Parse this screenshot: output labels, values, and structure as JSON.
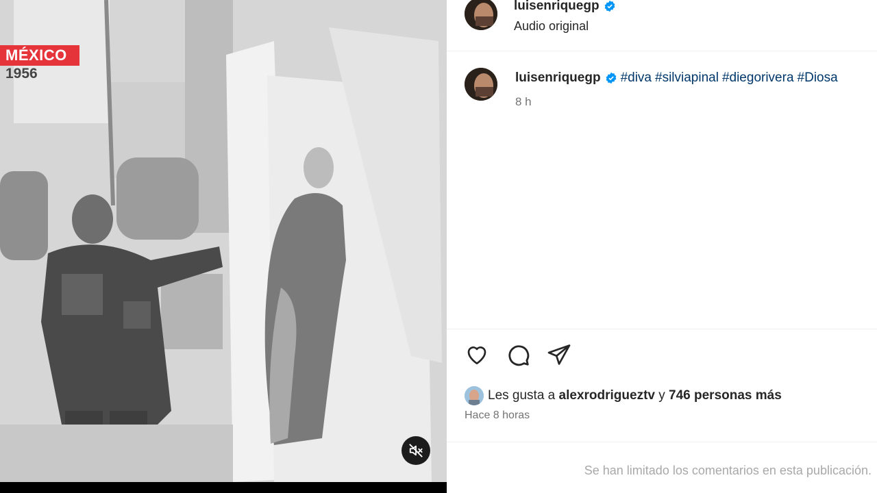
{
  "video": {
    "location_badge": "MÉXICO",
    "year": "1956",
    "mute_icon": "speaker-muted-icon"
  },
  "post": {
    "author": "luisenriquegp",
    "audio": "Audio original",
    "caption": {
      "author": "luisenriquegp",
      "hashtags": [
        "#diva",
        "#silviapinal",
        "#diegorivera",
        "#Diosa"
      ],
      "time": "8 h"
    }
  },
  "actions": {
    "like_icon": "heart-icon",
    "comment_icon": "comment-icon",
    "share_icon": "send-icon"
  },
  "likes": {
    "prefix": "Les gusta a",
    "user": "alexrodrigueztv",
    "connector": "y",
    "others": "746 personas más"
  },
  "timestamp": "Hace 8 horas",
  "comments_notice": "Se han limitado los comentarios en esta publicación.",
  "colors": {
    "badge_red": "#e5353a",
    "hashtag": "#00376b",
    "verified": "#0095f6",
    "muted_text": "#737373"
  }
}
